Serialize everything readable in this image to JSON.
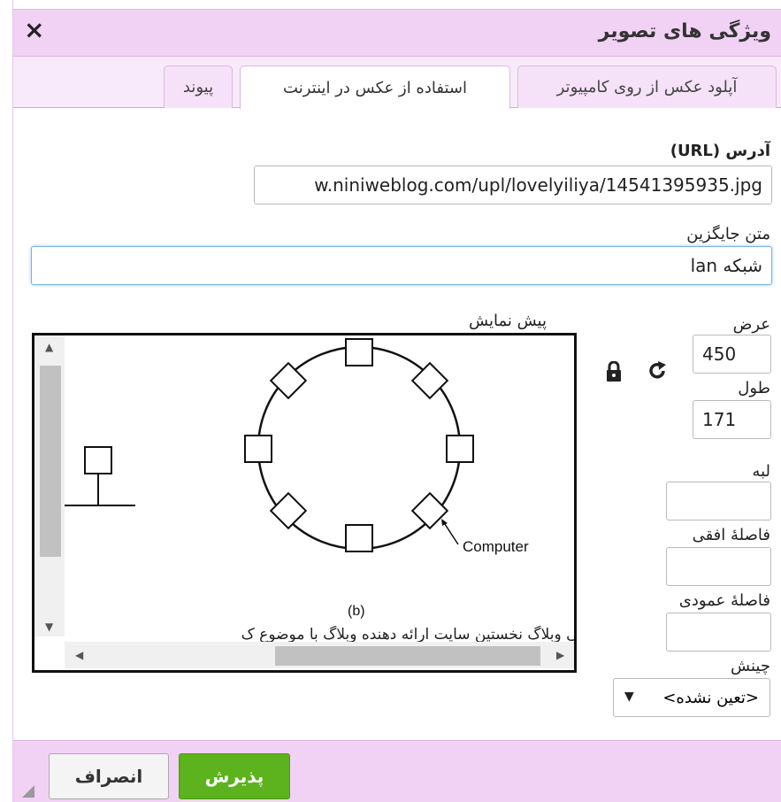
{
  "dialog": {
    "title": "ویژگی های تصویر",
    "close_icon": "×"
  },
  "tabs": [
    {
      "label": "آپلود عکس از روی کامپیوتر"
    },
    {
      "label": "استفاده از عکس در اینترنت"
    },
    {
      "label": "پیوند"
    }
  ],
  "active_tab": "استفاده از عکس در اینترنت",
  "form": {
    "url_label": "آدرس (URL)",
    "url_value": "w.niniweblog.com/upl/lovelyiliya/14541395935.jpg",
    "alt_label": "متن جایگزین",
    "alt_value": "شبکه lan",
    "width_label": "عرض",
    "width_value": "450",
    "height_label": "طول",
    "height_value": "171",
    "border_label": "لبه",
    "border_value": "",
    "hspace_label": "فاصلهٔ افقی",
    "hspace_value": "",
    "vspace_label": "فاصلهٔ عمودی",
    "vspace_value": "",
    "align_label": "چینش",
    "align_value": "<تعین نشده>",
    "lock_icon": "lock-icon",
    "reset_icon": "refresh-icon"
  },
  "preview": {
    "label": "پیش نمایش",
    "figure_label_computer": "Computer",
    "figure_label_b": "(b)",
    "caption_text": "نی وبلاگ نخستین سایت ارائه دهنده وبلاگ با موضوع ک"
  },
  "buttons": {
    "ok": "پذیرش",
    "cancel": "انصراف"
  },
  "colors": {
    "header_bg": "#f1d2f5",
    "ok_bg": "#5cb31d"
  }
}
